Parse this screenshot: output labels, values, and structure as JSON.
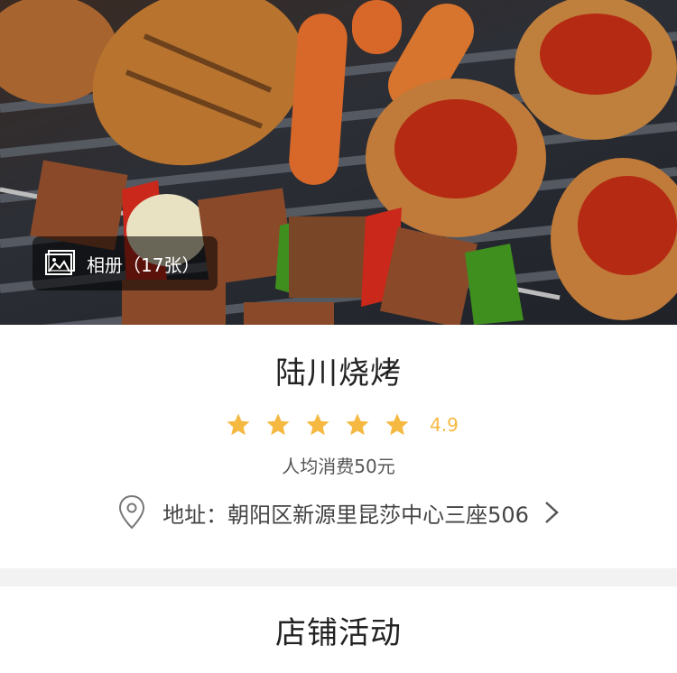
{
  "album": {
    "label": "相册（17张）",
    "icon": "image-gallery-icon"
  },
  "shop": {
    "name": "陆川烧烤",
    "rating": {
      "stars": 5,
      "score": "4.9",
      "star_color": "#f5b942"
    },
    "avg_price": "人均消费50元",
    "address": "地址：朝阳区新源里昆莎中心三座506"
  },
  "section": {
    "title": "店铺活动"
  },
  "colors": {
    "accent": "#f5b942",
    "text": "#333333",
    "background": "#f2f2f2"
  }
}
